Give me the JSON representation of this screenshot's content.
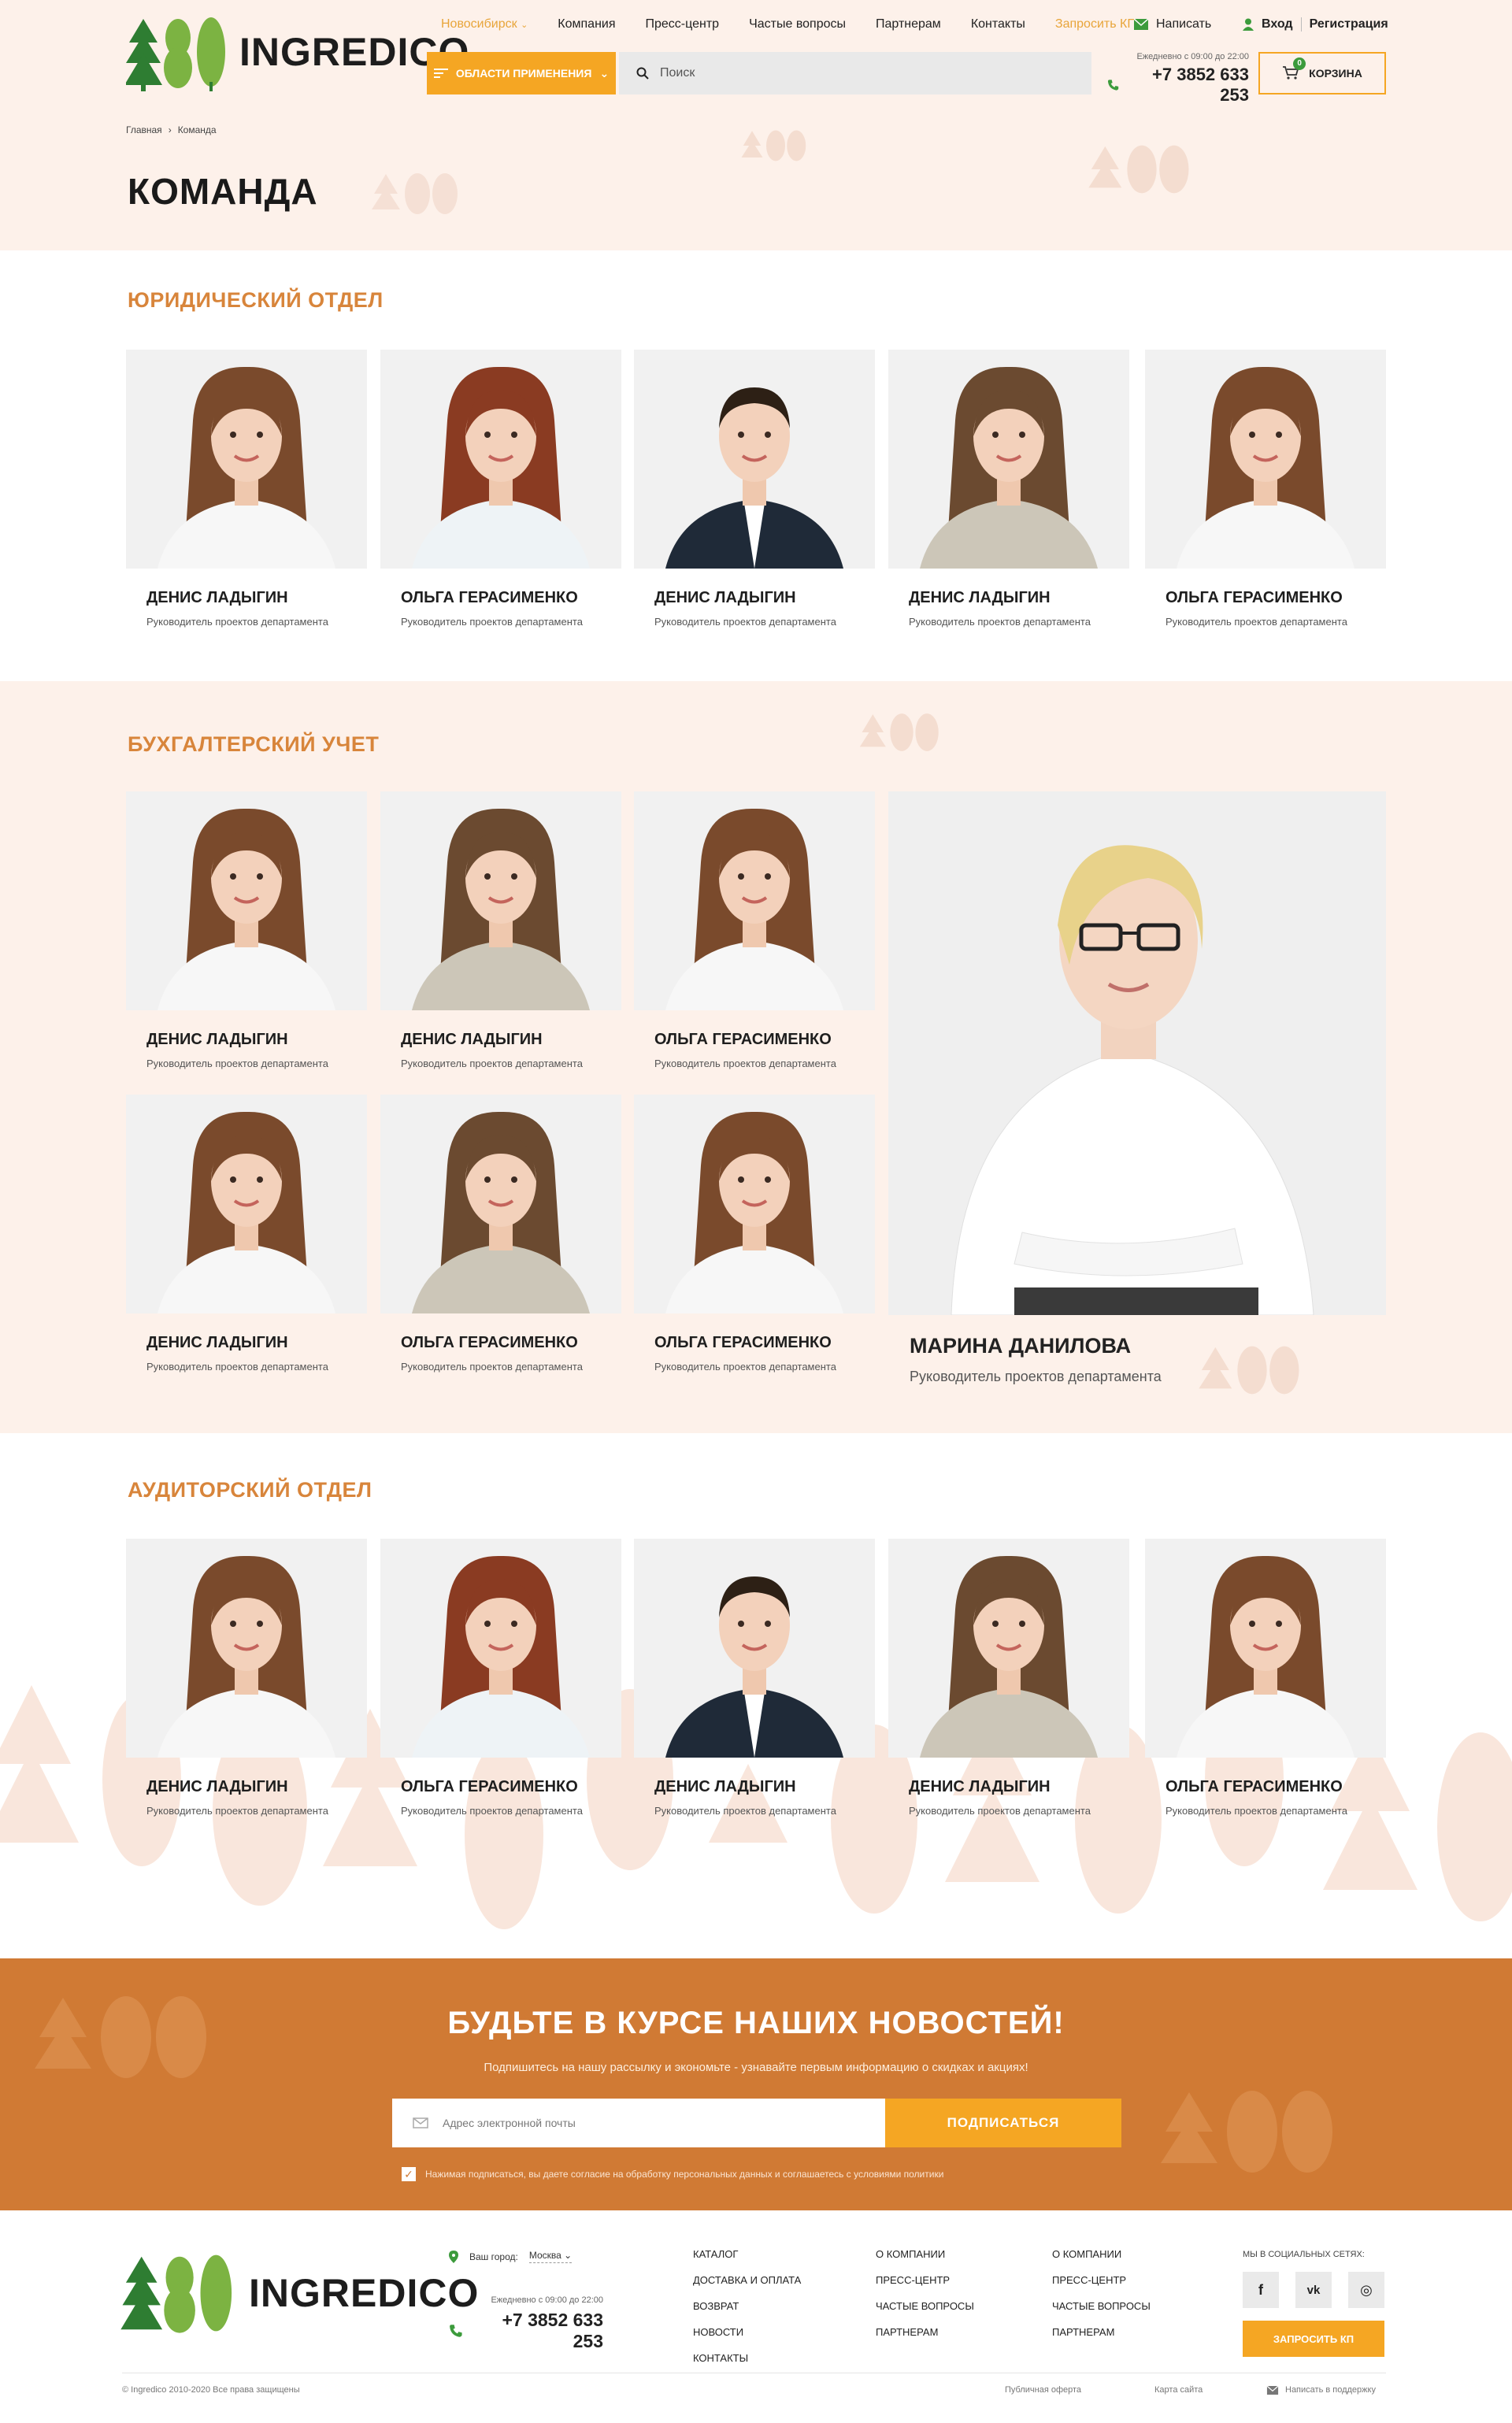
{
  "header": {
    "logo_text": "INGREDICO",
    "nav": {
      "city": "Новосибирск",
      "company": "Компания",
      "press": "Пресс-центр",
      "faq": "Частые вопросы",
      "partners": "Партнерам",
      "contacts": "Контакты",
      "request": "Запросить КП"
    },
    "write": "Написать",
    "login": "Вход",
    "register": "Регистрация",
    "catalog_button": "ОБЛАСТИ ПРИМЕНЕНИЯ",
    "search_placeholder": "Поиск",
    "hours": "Ежедневно с 09:00 до 22:00",
    "phone": "+7 3852 633 253",
    "cart_label": "КОРЗИНА",
    "cart_count": "0"
  },
  "breadcrumbs": {
    "home": "Главная",
    "current": "Команда"
  },
  "page_title": "КОМАНДА",
  "sections": {
    "legal": {
      "title": "ЮРИДИЧЕСКИЙ ОТДЕЛ",
      "members": [
        {
          "name": "ДЕНИС ЛАДЫГИН",
          "role": "Руководитель проектов департамента"
        },
        {
          "name": "ОЛЬГА ГЕРАСИМЕНКО",
          "role": "Руководитель проектов департамента"
        },
        {
          "name": "ДЕНИС ЛАДЫГИН",
          "role": "Руководитель проектов департамента"
        },
        {
          "name": "ДЕНИС ЛАДЫГИН",
          "role": "Руководитель проектов департамента"
        },
        {
          "name": "ОЛЬГА ГЕРАСИМЕНКО",
          "role": "Руководитель проектов департамента"
        }
      ]
    },
    "accounting": {
      "title": "БУХГАЛТЕРСКИЙ УЧЕТ",
      "members": [
        {
          "name": "ДЕНИС ЛАДЫГИН",
          "role": "Руководитель проектов департамента"
        },
        {
          "name": "ДЕНИС ЛАДЫГИН",
          "role": "Руководитель проектов департамента"
        },
        {
          "name": "ОЛЬГА ГЕРАСИМЕНКО",
          "role": "Руководитель проектов департамента"
        },
        {
          "name": "ДЕНИС ЛАДЫГИН",
          "role": "Руководитель проектов департамента"
        },
        {
          "name": "ОЛЬГА ГЕРАСИМЕНКО",
          "role": "Руководитель проектов департамента"
        },
        {
          "name": "ОЛЬГА ГЕРАСИМЕНКО",
          "role": "Руководитель проектов департамента"
        }
      ],
      "featured": {
        "name": "МАРИНА ДАНИЛОВА",
        "role": "Руководитель проектов департамента"
      }
    },
    "audit": {
      "title": "АУДИТОРСКИЙ ОТДЕЛ",
      "members": [
        {
          "name": "ДЕНИС ЛАДЫГИН",
          "role": "Руководитель проектов департамента"
        },
        {
          "name": "ОЛЬГА ГЕРАСИМЕНКО",
          "role": "Руководитель проектов департамента"
        },
        {
          "name": "ДЕНИС ЛАДЫГИН",
          "role": "Руководитель проектов департамента"
        },
        {
          "name": "ДЕНИС ЛАДЫГИН",
          "role": "Руководитель проектов департамента"
        },
        {
          "name": "ОЛЬГА ГЕРАСИМЕНКО",
          "role": "Руководитель проектов департамента"
        }
      ]
    }
  },
  "newsletter": {
    "title": "БУДЬТЕ В КУРСЕ НАШИХ НОВОСТЕЙ!",
    "subtitle": "Подпишитесь на нашу рассылку и экономьте - узнавайте первым информацию о скидках и акциях!",
    "email_placeholder": "Адрес электронной почты",
    "button": "ПОДПИСАТЬСЯ",
    "agreement": "Нажимая подписаться, вы даете согласие на обработку персональных данных и соглашаетесь с условиями политики"
  },
  "footer": {
    "logo_text": "INGREDICO",
    "city_label": "Ваш город:",
    "city_value": "Москва",
    "hours": "Ежедневно с 09:00 до 22:00",
    "phone": "+7 3852 633 253",
    "col1": [
      "КАТАЛОГ",
      "ДОСТАВКА И ОПЛАТА",
      "ВОЗВРАТ",
      "НОВОСТИ",
      "КОНТАКТЫ"
    ],
    "col2": [
      "О КОМПАНИИ",
      "ПРЕСС-ЦЕНТР",
      "ЧАСТЫЕ ВОПРОСЫ",
      "ПАРТНЕРАМ"
    ],
    "col3": [
      "О КОМПАНИИ",
      "ПРЕСС-ЦЕНТР",
      "ЧАСТЫЕ ВОПРОСЫ",
      "ПАРТНЕРАМ"
    ],
    "social_title": "МЫ В СОЦИАЛЬНЫХ СЕТЯХ:",
    "social": {
      "fb": "f",
      "vk": "vk",
      "ig": "◎"
    },
    "cta": "ЗАПРОСИТЬ КП",
    "copyright": "© Ingredico 2010-2020 Все права защищены",
    "offer": "Публичная оферта",
    "sitemap": "Карта сайта",
    "support": "Написать в поддержку"
  },
  "colors": {
    "accent": "#f5a623",
    "brand_orange": "#d07a34",
    "section_title": "#d8853b",
    "band": "#fdf1ea"
  }
}
